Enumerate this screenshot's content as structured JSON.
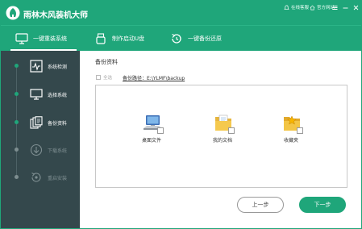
{
  "app": {
    "title": "雨林木风装机大师"
  },
  "titlebar": {
    "online_service": "在线客服",
    "website": "官方网站"
  },
  "tabs": [
    {
      "label": "一键重装系统",
      "icon": "monitor-icon"
    },
    {
      "label": "制作启动U盘",
      "icon": "usb-icon"
    },
    {
      "label": "一键备份还原",
      "icon": "restore-icon"
    }
  ],
  "steps": [
    {
      "label": "系统检测",
      "icon": "system-check-icon",
      "state": "done"
    },
    {
      "label": "选择系统",
      "icon": "monitor-icon",
      "state": "done"
    },
    {
      "label": "备份资料",
      "icon": "backup-files-icon",
      "state": "current"
    },
    {
      "label": "下载系统",
      "icon": "download-icon",
      "state": "pending"
    },
    {
      "label": "重启安装",
      "icon": "restart-icon",
      "state": "pending"
    }
  ],
  "main": {
    "section_title": "备份资料",
    "select_all": "全选",
    "backup_path": "备份路径：E:\\YLMF\\backup",
    "files": [
      {
        "label": "桌面文件",
        "icon": "desktop-computer-icon"
      },
      {
        "label": "我的文档",
        "icon": "documents-folder-icon"
      },
      {
        "label": "收藏夹",
        "icon": "favorites-folder-icon"
      }
    ]
  },
  "buttons": {
    "prev": "上一步",
    "next": "下一步"
  },
  "colors": {
    "accent": "#1fa67a",
    "sidebar": "#34484c"
  }
}
